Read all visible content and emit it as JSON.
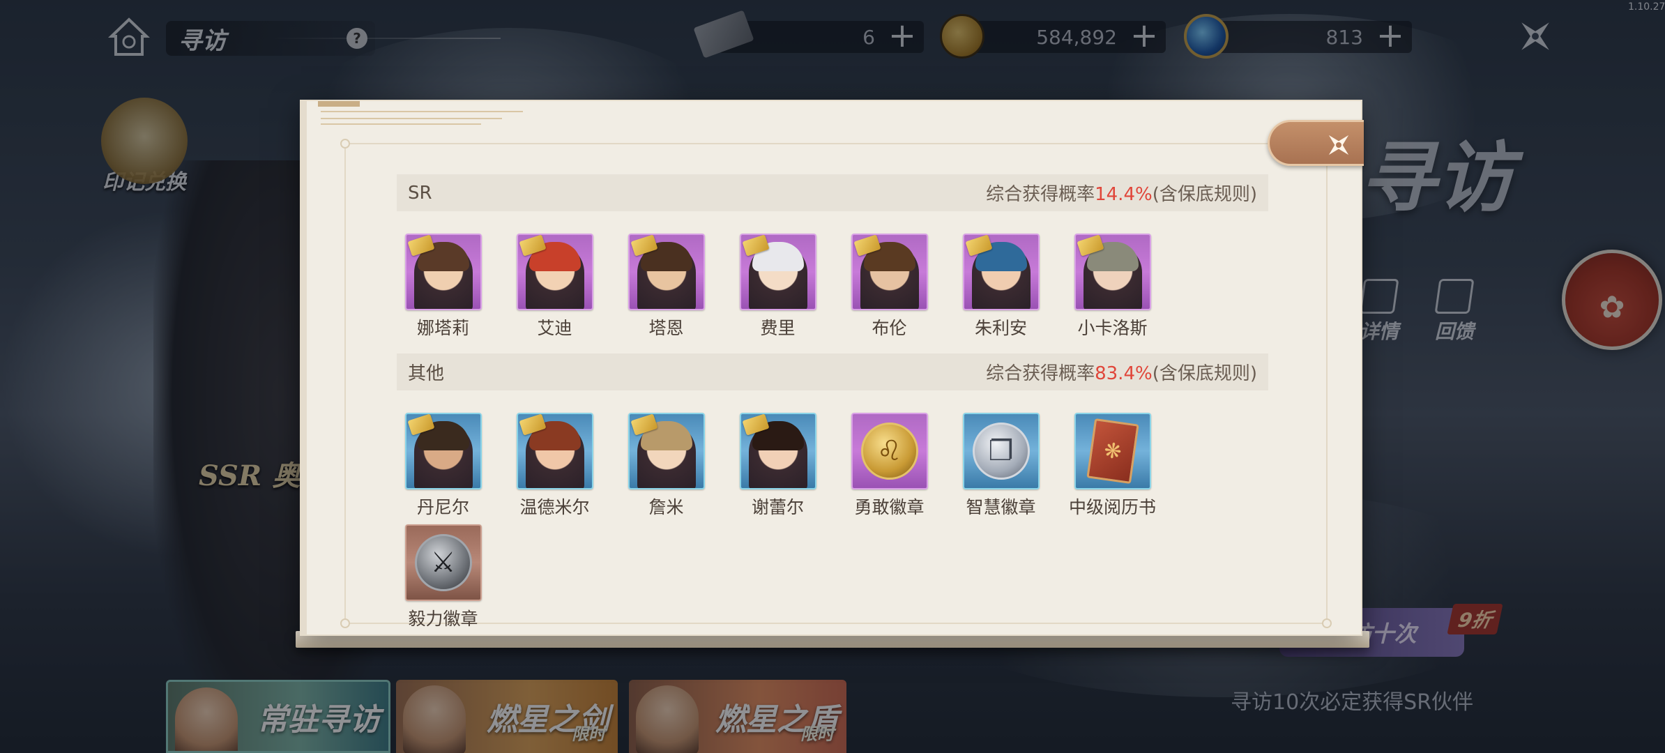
{
  "version": "1.10.27",
  "topbar": {
    "title": "寻访",
    "help": "?",
    "resources": [
      {
        "name": "ticket",
        "value": "6"
      },
      {
        "name": "coin",
        "value": "584,892"
      },
      {
        "name": "gem",
        "value": "813"
      }
    ],
    "plus": "+"
  },
  "left": {
    "voucher_label": "印记兑换"
  },
  "background": {
    "ssr_prefix": "SSR",
    "ssr_name": "奥久",
    "big_title": "寻访",
    "side_buttons": [
      "详情",
      "回馈"
    ],
    "ten_pull_label": "寻访十次",
    "discount": "9折",
    "guarantee_text": "寻访10次必定获得SR伙伴",
    "banners": [
      {
        "name": "常驻寻访",
        "sub": ""
      },
      {
        "name": "燃星之剑",
        "sub": "限时"
      },
      {
        "name": "燃星之盾",
        "sub": "限时"
      }
    ]
  },
  "modal": {
    "sections": [
      {
        "tier": "SR",
        "rate_prefix": "综合获得概率",
        "rate": "14.4%",
        "rate_suffix": "(含保底规则)",
        "items": [
          {
            "name": "娜塔莉",
            "kind": "portrait",
            "frame": "purple"
          },
          {
            "name": "艾迪",
            "kind": "portrait",
            "frame": "purple"
          },
          {
            "name": "塔恩",
            "kind": "portrait",
            "frame": "purple"
          },
          {
            "name": "费里",
            "kind": "portrait",
            "frame": "purple"
          },
          {
            "name": "布伦",
            "kind": "portrait",
            "frame": "purple"
          },
          {
            "name": "朱利安",
            "kind": "portrait",
            "frame": "purple"
          },
          {
            "name": "小卡洛斯",
            "kind": "portrait",
            "frame": "purple"
          }
        ]
      },
      {
        "tier": "其他",
        "rate_prefix": "综合获得概率",
        "rate": "83.4%",
        "rate_suffix": "(含保底规则)",
        "items": [
          {
            "name": "丹尼尔",
            "kind": "portrait",
            "frame": "blue"
          },
          {
            "name": "温德米尔",
            "kind": "portrait",
            "frame": "blue"
          },
          {
            "name": "詹米",
            "kind": "portrait",
            "frame": "blue"
          },
          {
            "name": "谢蕾尔",
            "kind": "portrait",
            "frame": "blue"
          },
          {
            "name": "勇敢徽章",
            "kind": "badge",
            "frame": "purple"
          },
          {
            "name": "智慧徽章",
            "kind": "badge",
            "frame": "blue"
          },
          {
            "name": "中级阅历书",
            "kind": "book",
            "frame": "blue"
          },
          {
            "name": "毅力徽章",
            "kind": "badge",
            "frame": "brown"
          }
        ]
      }
    ]
  },
  "colors": {
    "rate_highlight": "#e0463a",
    "modal_bg": "#f1ede4",
    "close_button": "#b07a58"
  }
}
